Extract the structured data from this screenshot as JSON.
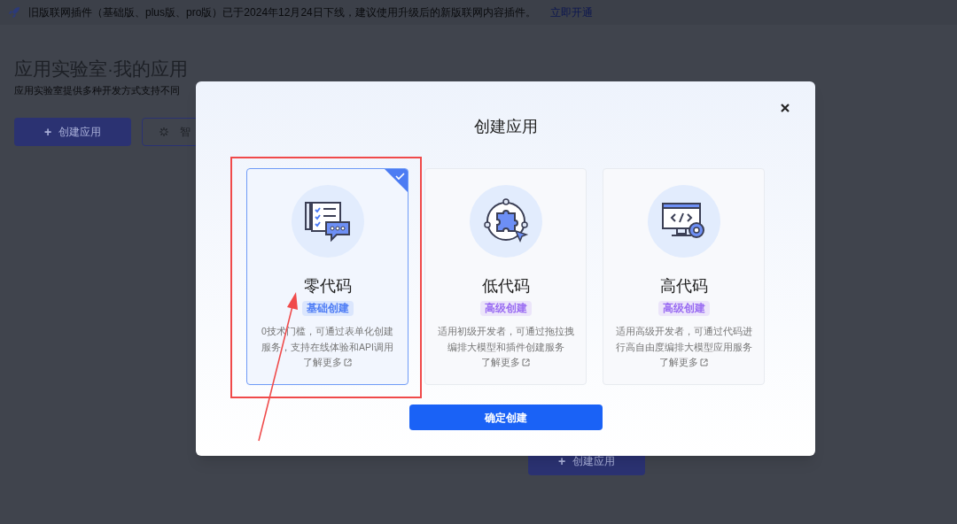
{
  "banner": {
    "text": "旧版联网插件（基础版、plus版、pro版）已于2024年12月24日下线，建议使用升级后的新版联网内容插件。",
    "link": "立即开通"
  },
  "page": {
    "title": "应用实验室·我的应用",
    "subtitle": "应用实验室提供多种开发方式支持不同",
    "buttons": [
      {
        "icon": "+",
        "label": "创建应用",
        "kind": "primary"
      },
      {
        "label": "智",
        "kind": "outline"
      }
    ]
  },
  "empty_state_button": {
    "icon": "+",
    "label": "创建应用"
  },
  "modal": {
    "title": "创建应用",
    "options": [
      {
        "kind": "form",
        "title": "零代码",
        "badge": "基础创建",
        "color": "#4d7cf5",
        "description": "0技术门槛，可通过表单化创建服务，支持在线体验和API调用",
        "link": "了解更多",
        "selected": true
      },
      {
        "kind": "plugin",
        "title": "低代码",
        "badge": "高级创建",
        "color": "#9a6cf2",
        "description": "适用初级开发者，可通过拖拉拽编排大模型和插件创建服务",
        "link": "了解更多",
        "selected": false
      },
      {
        "kind": "code",
        "title": "高代码",
        "badge": "高级创建",
        "color": "#9a6cf2",
        "description": "适用高级开发者，可通过代码进行高自由度编排大模型应用服务",
        "link": "了解更多",
        "selected": false
      }
    ],
    "confirm": "确定创建"
  }
}
